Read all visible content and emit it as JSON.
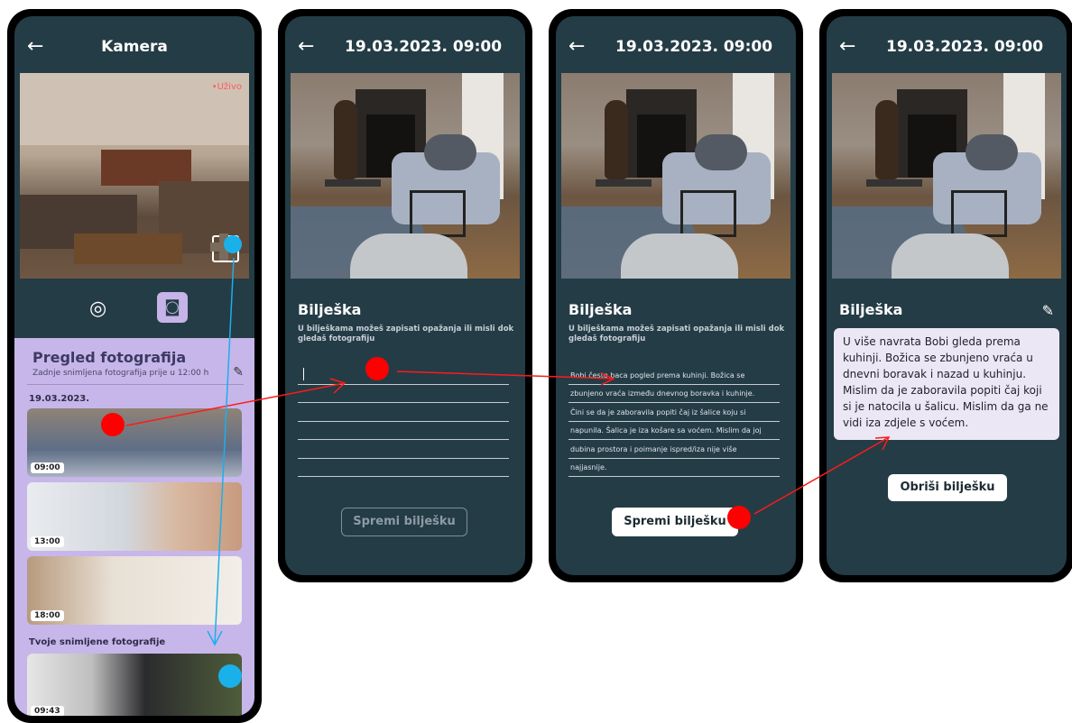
{
  "screen1": {
    "title": "Kamera",
    "live_label": "•Uživo",
    "gallery": {
      "title": "Pregled fotografija",
      "subtitle": "Zadnje snimljena fotografija prije u 12:00 h",
      "date": "19.03.2023.",
      "thumbs": [
        "09:00",
        "13:00",
        "18:00"
      ],
      "section": "Tvoje snimljene fotografije",
      "own_thumb": "09:43"
    }
  },
  "screen2": {
    "title": "19.03.2023.  09:00",
    "note_heading": "Bilješka",
    "note_hint": "U bilješkama možeš zapisati opažanja ili misli dok gledaš fotografiju",
    "save_label": "Spremi bilješku"
  },
  "screen3": {
    "title": "19.03.2023.  09:00",
    "note_heading": "Bilješka",
    "note_hint": "U bilješkama možeš zapisati opažanja ili misli dok gledaš fotografiju",
    "lines": [
      "Bobi često baca pogled prema kuhinji. Božica se",
      "zbunjeno vraća između dnevnog boravka i kuhinje.",
      "Čini se da je zaboravila popiti čaj iz šalice koju si",
      "napunila. Šalica je iza košare sa voćem. Mislim da joj",
      "dubina prostora i poimanje ispred/iza nije više",
      "najjasnije."
    ],
    "save_label": "Spremi bilješku"
  },
  "screen4": {
    "title": "19.03.2023.  09:00",
    "note_heading": "Bilješka",
    "note_text": "U više navrata Bobi gleda prema kuhinji. Božica se zbunjeno vraća u dnevni boravak i nazad u kuhinju. Mislim da je zaboravila popiti čaj koji si je natocila u šalicu. Mislim da ga ne vidi iza zdjele s voćem.",
    "delete_label": "Obriši bilješku"
  },
  "colors": {
    "screen_bg": "#243c46",
    "panel_bg": "#c7b6ea",
    "annotation_red": "#ff0000",
    "annotation_blue": "#1ab0ea"
  }
}
